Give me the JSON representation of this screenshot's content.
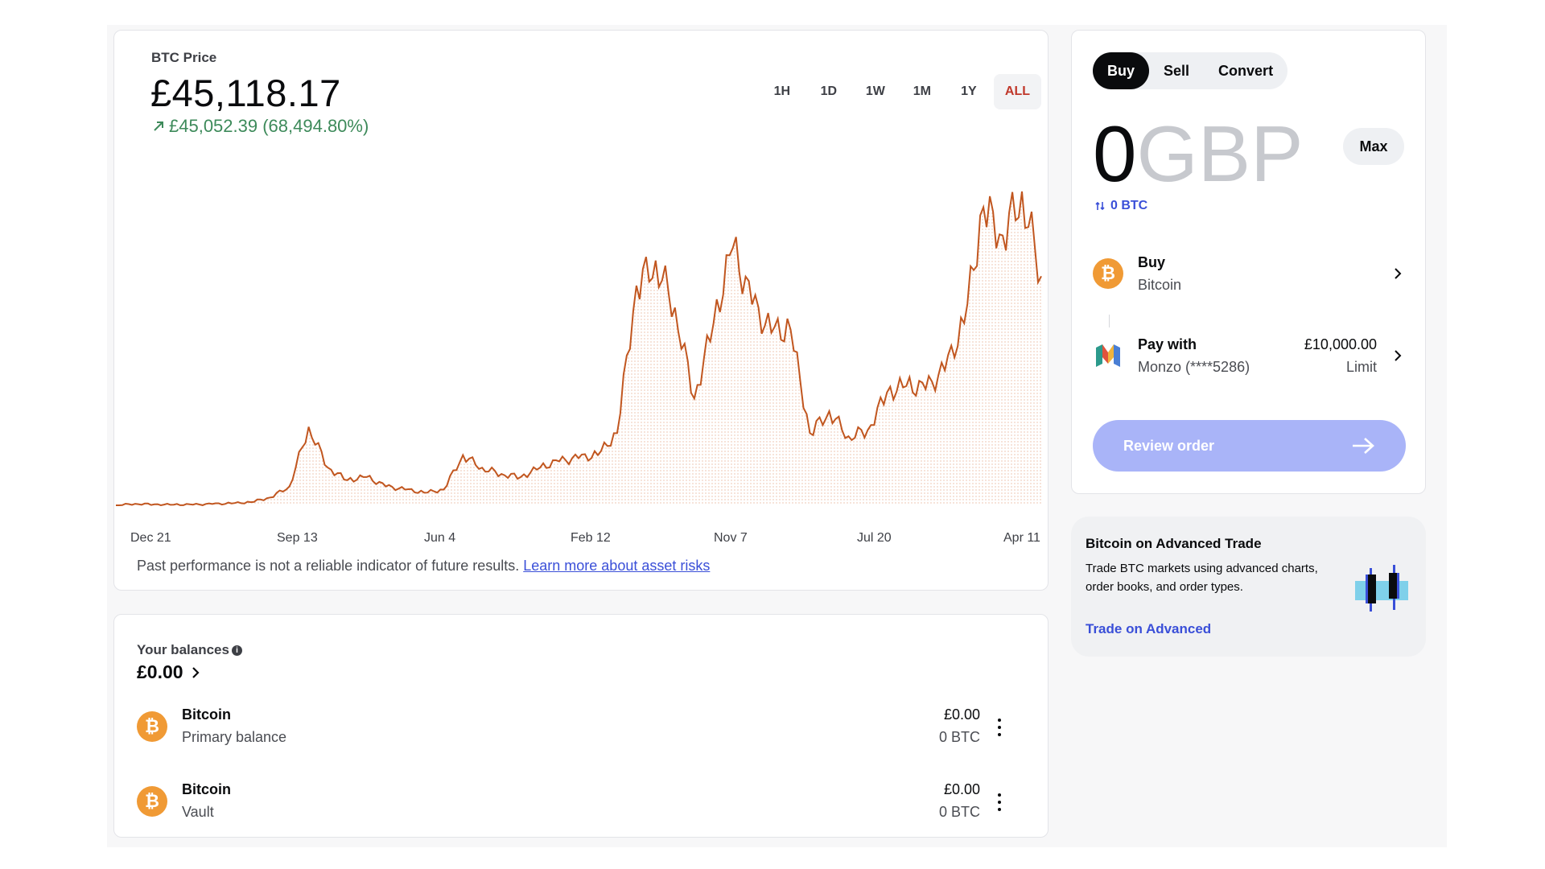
{
  "price_card": {
    "label": "BTC Price",
    "price": "£45,118.17",
    "change": "£45,052.39 (68,494.80%)",
    "timeframes": [
      "1H",
      "1D",
      "1W",
      "1M",
      "1Y",
      "ALL"
    ],
    "active_timeframe": "ALL",
    "disclaimer": "Past performance is not a reliable indicator of future results.",
    "disclaimer_link": "Learn more about asset risks"
  },
  "chart_data": {
    "type": "area",
    "x_tick_labels": [
      "Dec 21",
      "Sep 13",
      "Jun 4",
      "Feb 12",
      "Nov 7",
      "Jul 20",
      "Apr 11"
    ],
    "series_color": "#c1561f",
    "y_relative": [
      0.0,
      0.005,
      0.003,
      0.002,
      0.002,
      0.004,
      0.006,
      0.01,
      0.025,
      0.06,
      0.25,
      0.12,
      0.08,
      0.09,
      0.06,
      0.05,
      0.04,
      0.05,
      0.16,
      0.12,
      0.1,
      0.09,
      0.12,
      0.14,
      0.15,
      0.16,
      0.23,
      0.7,
      0.78,
      0.63,
      0.34,
      0.58,
      0.82,
      0.64,
      0.55,
      0.56,
      0.23,
      0.3,
      0.22,
      0.24,
      0.36,
      0.38,
      0.37,
      0.43,
      0.58,
      0.95,
      0.86,
      1.0,
      0.73
    ]
  },
  "balances": {
    "label": "Your balances",
    "total": "£0.00",
    "rows": [
      {
        "name": "Bitcoin",
        "sub": "Primary balance",
        "fiat": "£0.00",
        "crypto": "0 BTC"
      },
      {
        "name": "Bitcoin",
        "sub": "Vault",
        "fiat": "£0.00",
        "crypto": "0 BTC"
      }
    ]
  },
  "trade": {
    "tabs": [
      "Buy",
      "Sell",
      "Convert"
    ],
    "active_tab": "Buy",
    "amount": "0",
    "currency": "GBP",
    "max_label": "Max",
    "converted": "0 BTC",
    "buy_row": {
      "title": "Buy",
      "sub": "Bitcoin"
    },
    "pay_row": {
      "title": "Pay with",
      "sub": "Monzo (****5286)",
      "limit_amount": "£10,000.00",
      "limit_label": "Limit"
    },
    "review_label": "Review order"
  },
  "advanced": {
    "title": "Bitcoin on Advanced Trade",
    "text": "Trade BTC markets using advanced charts, order books, and order types.",
    "link": "Trade on Advanced"
  },
  "colors": {
    "accent_blue": "#3a4fd8",
    "positive_green": "#3d8a5a",
    "bitcoin_orange": "#f09a35",
    "chart_line": "#c1561f",
    "active_timeframe_text": "#c0382b"
  }
}
